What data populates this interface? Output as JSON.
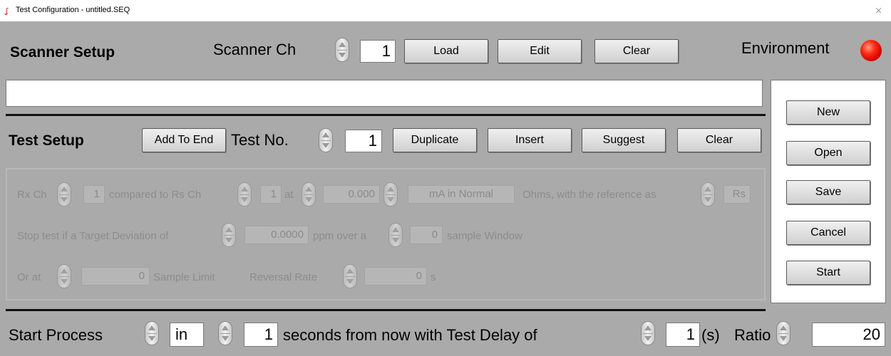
{
  "window": {
    "title": "Test Configuration - untitled.SEQ",
    "close_glyph": "×"
  },
  "scanner": {
    "heading": "Scanner Setup",
    "ch_label": "Scanner Ch",
    "ch_value": "1",
    "load": "Load",
    "edit": "Edit",
    "clear": "Clear",
    "env_label": "Environment",
    "env_led_color": "#ff1a00"
  },
  "side": {
    "new": "New",
    "open": "Open",
    "save": "Save",
    "cancel": "Cancel",
    "start": "Start"
  },
  "test": {
    "heading": "Test Setup",
    "add_to_end": "Add To End",
    "no_label": "Test No.",
    "no_value": "1",
    "duplicate": "Duplicate",
    "insert": "Insert",
    "suggest": "Suggest",
    "clear": "Clear"
  },
  "params": {
    "rx_label": "Rx Ch",
    "rx_value": "1",
    "compared_label": "compared to Rs Ch",
    "rs_value": "1",
    "at_label": "at",
    "current_value": "0.000",
    "mode_value": "mA in Normal",
    "ohms_label": "Ohms, with the reference as",
    "ref_value": "Rs",
    "stop_label": "Stop test if a Target Deviation of",
    "dev_value": "0.0000",
    "ppm_label": "ppm over a",
    "window_value": "0",
    "window_label": "sample Window",
    "or_label": "Or at",
    "limit_value": "0",
    "limit_label": "Sample Limit",
    "rev_label": "Reversal Rate",
    "rev_value": "0",
    "rev_unit": "s"
  },
  "footer": {
    "start_label": "Start Process",
    "mode_value": "in",
    "seconds_value": "1",
    "seconds_label": "seconds from now with Test Delay of",
    "delay_value": "1",
    "delay_unit": "(s)",
    "ratio_label": "Ratio",
    "ratio_value": "20"
  }
}
